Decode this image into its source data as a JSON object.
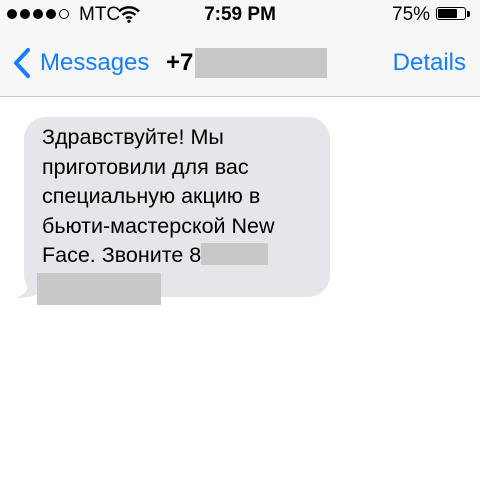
{
  "status_bar": {
    "signal_bars": 5,
    "signal_filled": 4,
    "carrier": "МТС",
    "time": "7:59 PM",
    "battery_percent": "75%",
    "battery_level": 0.75,
    "wifi_icon": "wifi-icon"
  },
  "nav": {
    "back_label": "Messages",
    "back_icon": "chevron-left-icon",
    "contact_prefix": "+7",
    "details_label": "Details",
    "accent_color": "#147efb"
  },
  "message": {
    "lines": [
      "Здравствуйте! Мы",
      "приготовили для вас",
      "специальную акцию в",
      "бьюти-мастерской New",
      "Face. Звоните 8"
    ],
    "bubble_color": "#e5e5ea"
  }
}
